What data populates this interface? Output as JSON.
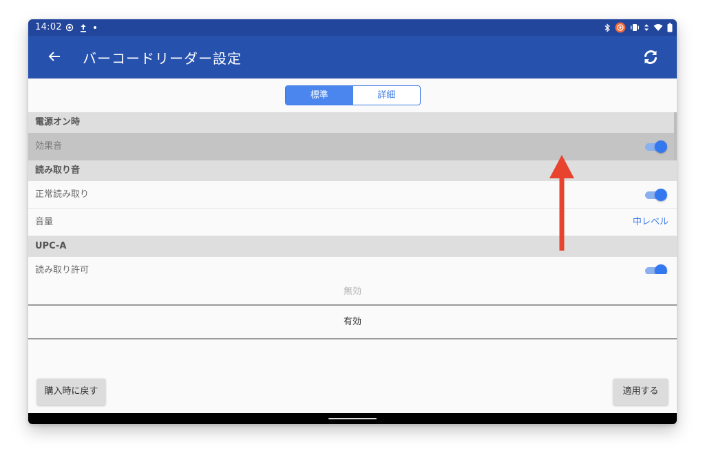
{
  "status_bar": {
    "time": "14:02",
    "left_icons": [
      "location-icon",
      "upload-icon",
      "dot-icon"
    ],
    "right_icons": [
      "bluetooth-icon",
      "record-icon",
      "vibrate-icon",
      "data-arrows-icon",
      "wifi-icon",
      "battery-icon"
    ]
  },
  "app_bar": {
    "title": "バーコードリーダー設定",
    "back_icon": "arrow-left-icon",
    "refresh_icon": "refresh-icon",
    "color": "#2651ad"
  },
  "segment": {
    "options": [
      {
        "label": "標準",
        "active": true
      },
      {
        "label": "詳細",
        "active": false
      }
    ],
    "accent": "#4a86ee"
  },
  "list": {
    "sections": [
      {
        "header": "電源オン時",
        "rows": [
          {
            "label": "効果音",
            "toggle": true,
            "highlighted": true
          }
        ]
      },
      {
        "header": "読み取り音",
        "rows": [
          {
            "label": "正常読み取り",
            "toggle": true
          },
          {
            "label": "音量",
            "value": "中レベル"
          }
        ]
      },
      {
        "header": "UPC-A",
        "rows": [
          {
            "label": "読み取り許可",
            "toggle": true
          }
        ]
      }
    ]
  },
  "picker": {
    "items": [
      "無効",
      "有効"
    ],
    "selected": "有効"
  },
  "buttons": {
    "reset": "購入時に戻す",
    "apply": "適用する"
  },
  "annotation": {
    "type": "swipe-up-arrow",
    "color": "#e8432f"
  }
}
